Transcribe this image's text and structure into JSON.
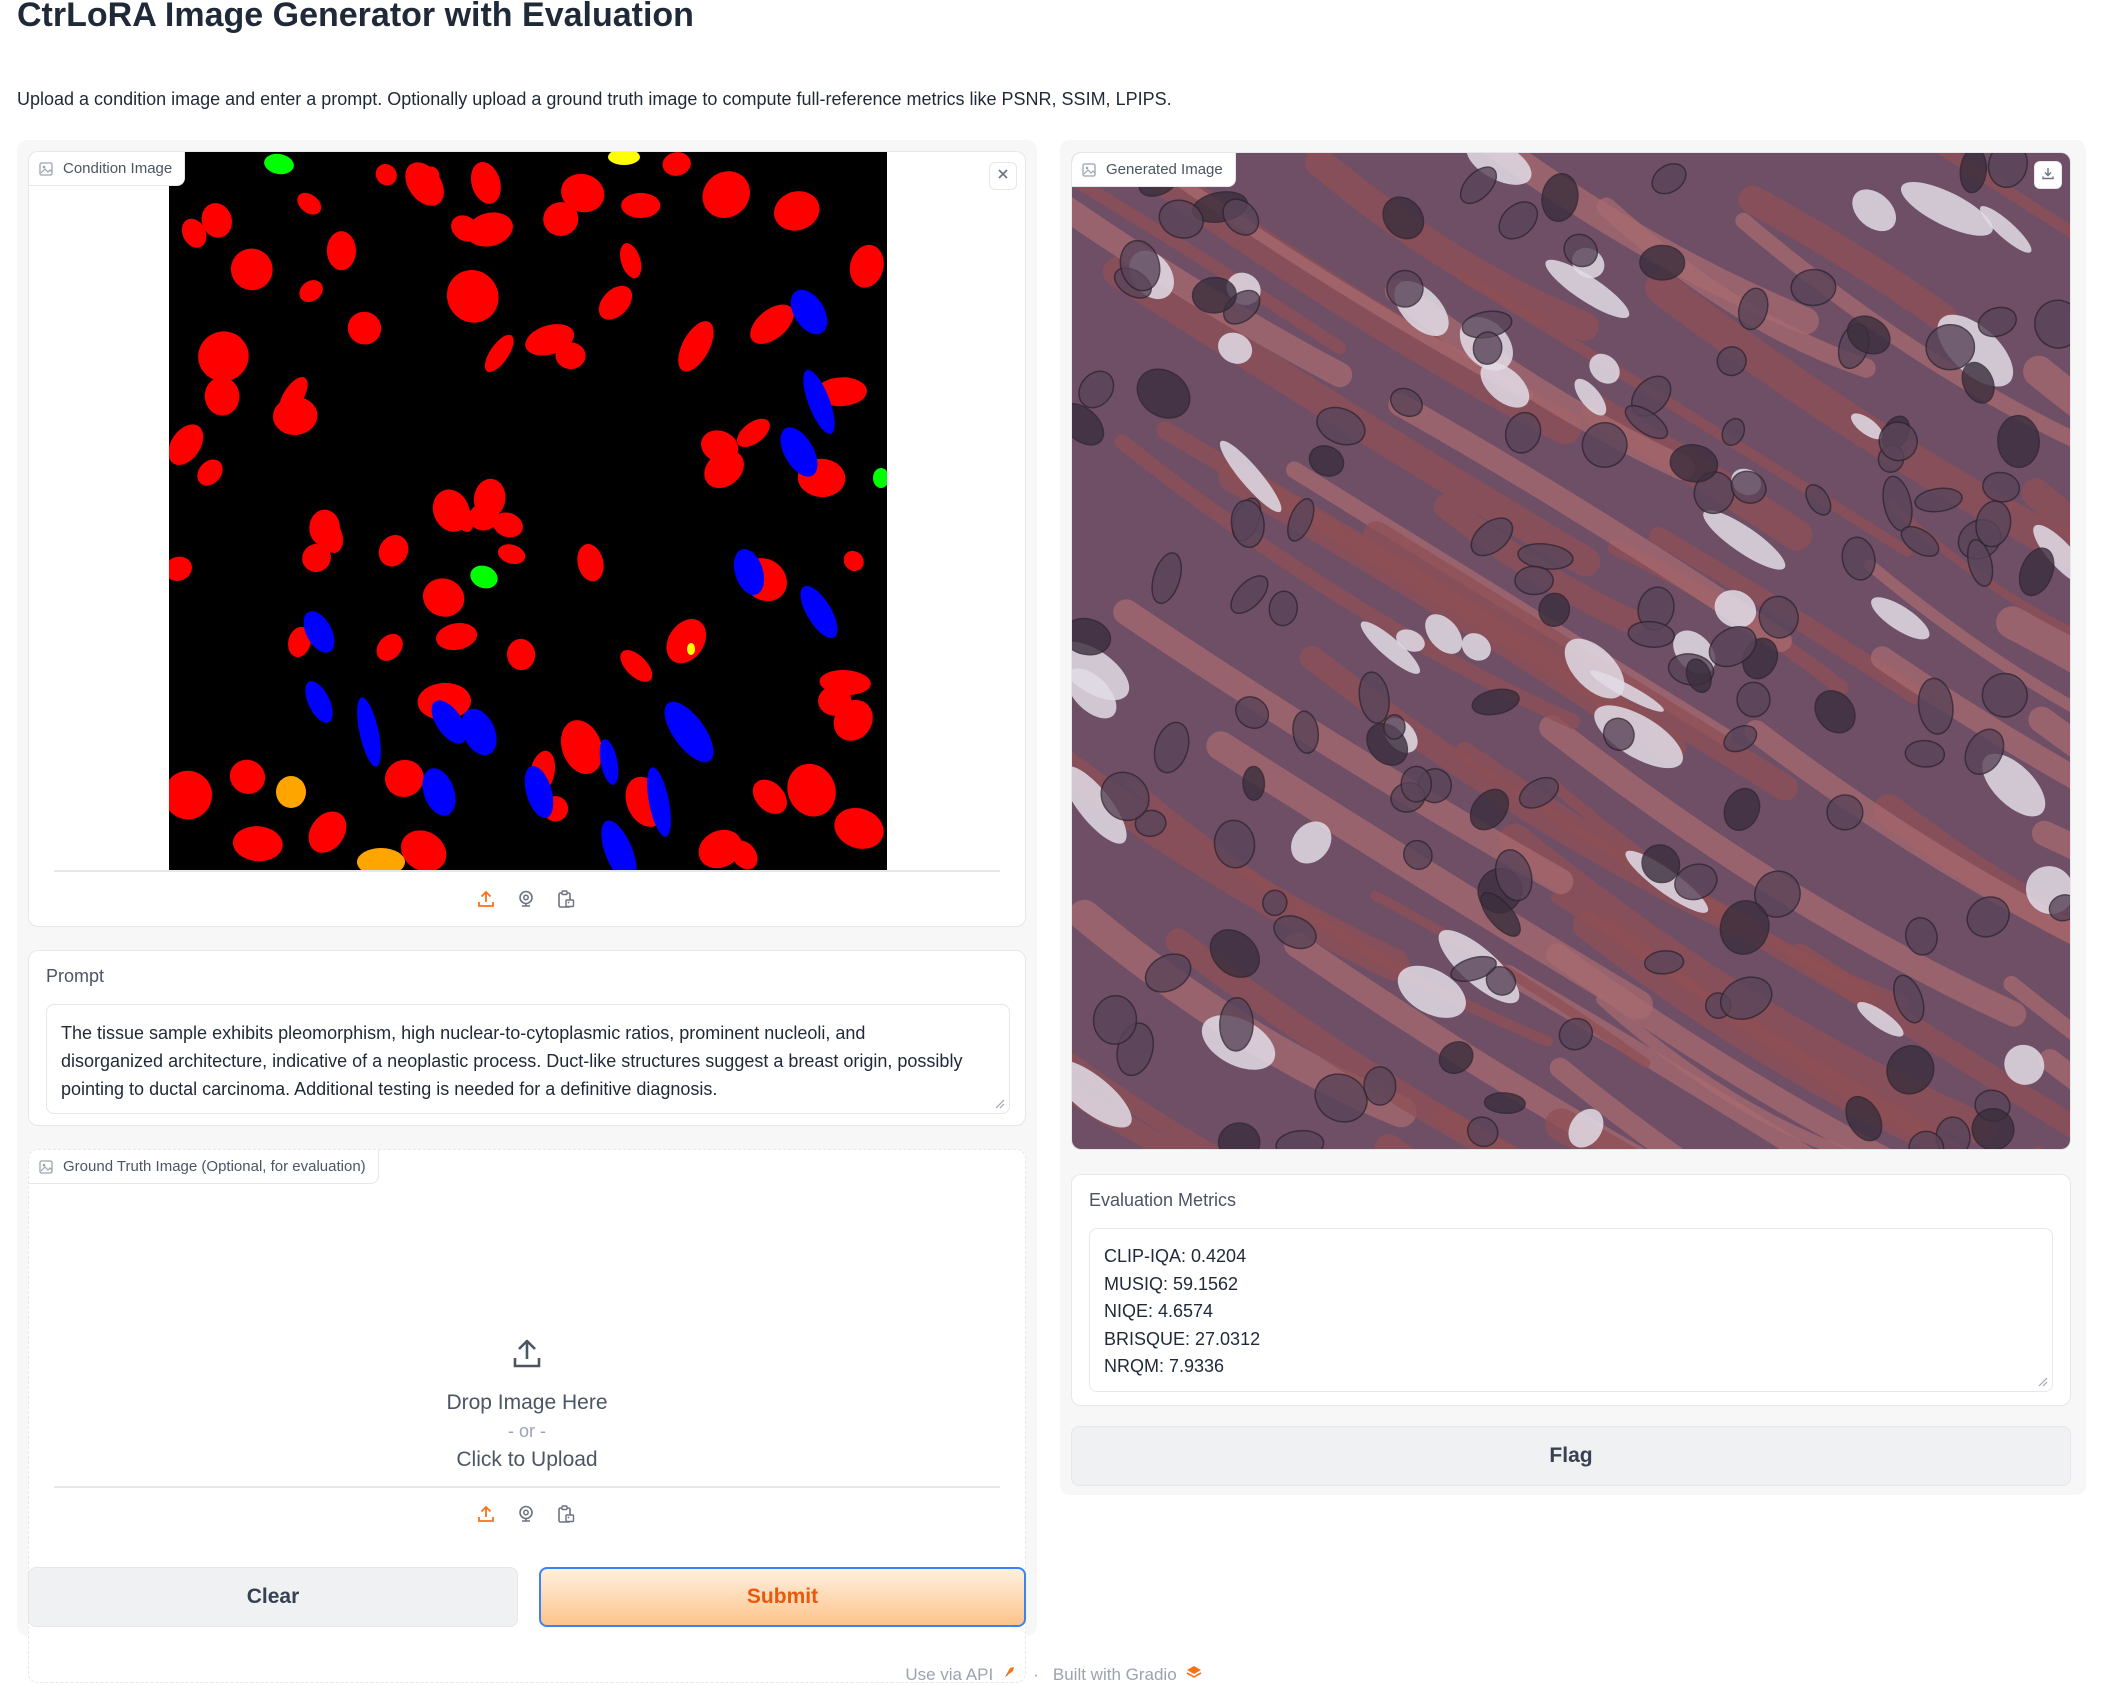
{
  "page": {
    "title": "CtrLoRA Image Generator with Evaluation",
    "description": "Upload a condition image and enter a prompt. Optionally upload a ground truth image to compute full-reference metrics like PSNR, SSIM, LPIPS."
  },
  "condition_image": {
    "label": "Condition Image",
    "icons": [
      "image-icon",
      "close-icon",
      "upload-icon",
      "webcam-icon",
      "clipboard-icon"
    ],
    "colors": {
      "background": "#000000",
      "red": "#ff0000",
      "blue": "#0000ff",
      "green": "#00ff00",
      "yellow": "#ffff00",
      "orange": "#ffa500"
    }
  },
  "prompt": {
    "label": "Prompt",
    "lines": [
      "The tissue sample exhibits pleomorphism, high nuclear-to-cytoplasmic ratios, prominent nucleoli, and",
      "disorganized architecture, indicative of a neoplastic process. Duct-like structures suggest a breast origin, possibly",
      "pointing to ductal carcinoma. Additional testing is needed for a definitive diagnosis."
    ]
  },
  "ground_truth": {
    "label": "Ground Truth Image (Optional, for evaluation)",
    "drop_text": "Drop Image Here",
    "or_text": "- or -",
    "upload_text": "Click to Upload"
  },
  "buttons": {
    "clear": "Clear",
    "submit": "Submit",
    "flag": "Flag"
  },
  "generated_image": {
    "label": "Generated Image",
    "icons": [
      "image-icon",
      "download-icon"
    ],
    "colors": {
      "base": "#6e4f66",
      "stroma": "#8f4f55",
      "light": "#e2dce6",
      "nucleus": "#3b2e3d"
    }
  },
  "metrics": {
    "label": "Evaluation Metrics",
    "lines": [
      "CLIP-IQA: 0.4204",
      "MUSIQ: 59.1562",
      "NIQE: 4.6574",
      "BRISQUE: 27.0312",
      "NRQM: 7.9336"
    ]
  },
  "footer": {
    "api": "Use via API",
    "separator": "·",
    "built": "Built with Gradio"
  },
  "colors": {
    "accent": "#f97316",
    "focus_border": "#3b82f6",
    "panel_bg": "#f7f7f8",
    "border": "#e5e7eb"
  }
}
